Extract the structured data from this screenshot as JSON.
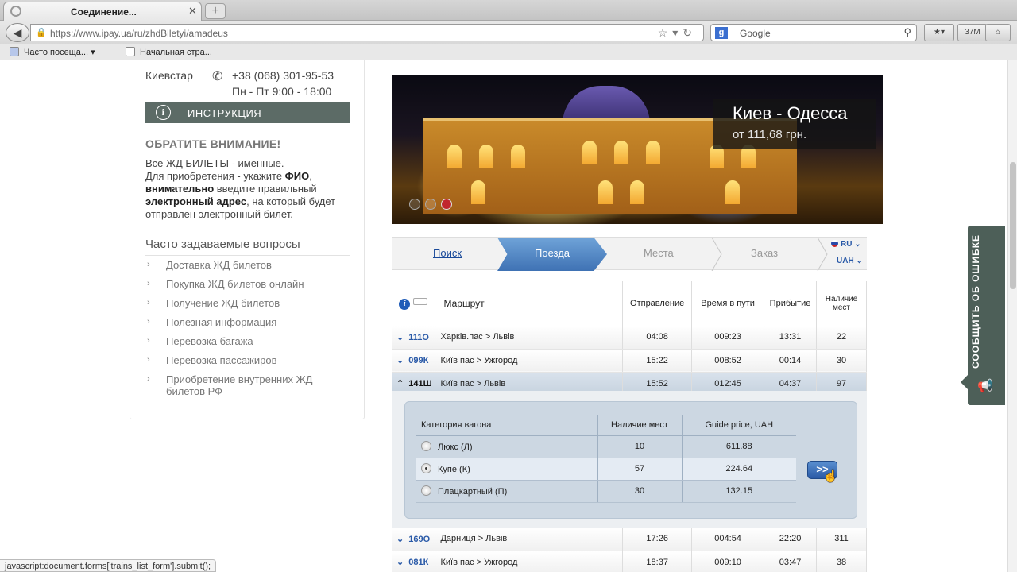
{
  "browser": {
    "tab_title": "Соединение...",
    "new_tab_label": "+",
    "url": "https://www.ipay.ua/ru/zhdBiletyi/amadeus",
    "search_engine": "Google",
    "download_label": "37M",
    "bookmarks": [
      "Часто посеща...",
      "Начальная стра..."
    ],
    "status_text": "javascript:document.forms['trains_list_form'].submit();"
  },
  "sidebar": {
    "contact_operator": "Киевстар",
    "contact_phone": "+38 (068) 301-95-53",
    "contact_hours": "Пн - Пт 9:00 - 18:00",
    "instruction_label": "ИНСТРУКЦИЯ",
    "notice_title": "ОБРАТИТЕ ВНИМАНИЕ!",
    "notice_line1": "Все ЖД БИЛЕТЫ - именные.",
    "notice_p1": "Для приобретения - укажите ",
    "notice_b1": "ФИО",
    "notice_p2": ",",
    "notice_b2": "внимательно",
    "notice_p3": " введите правильный ",
    "notice_b3": "электронный адрес",
    "notice_p4": ", на который будет отправлен электронный билет.",
    "faq_title": "Часто задаваемые вопросы",
    "faq_items": [
      "Доставка ЖД билетов",
      "Покупка ЖД билетов онлайн",
      "Получение ЖД билетов",
      "Полезная информация",
      "Перевозка багажа",
      "Перевозка пассажиров",
      "Приобретение внутренних ЖД билетов РФ"
    ]
  },
  "banner": {
    "route": "Киев - Одесса",
    "price": "от 111,68 грн."
  },
  "steps": {
    "search": "Поиск",
    "trains": "Поезда",
    "seats": "Места",
    "order": "Заказ",
    "language": "RU",
    "currency": "UAH"
  },
  "table": {
    "headers": {
      "route": "Маршрут",
      "departure": "Отправление",
      "duration": "Время в пути",
      "arrival": "Прибытие",
      "availability": "Наличие мест"
    },
    "rows": [
      {
        "number": "111О",
        "route": "Харків.пас > Львів",
        "departure": "04:08",
        "duration": "009:23",
        "arrival": "13:31",
        "seats": "22"
      },
      {
        "number": "099К",
        "route": "Київ пас > Ужгород",
        "departure": "15:22",
        "duration": "008:52",
        "arrival": "00:14",
        "seats": "30"
      },
      {
        "number": "141Ш",
        "route": "Київ пас > Львів",
        "departure": "15:52",
        "duration": "012:45",
        "arrival": "04:37",
        "seats": "97"
      },
      {
        "number": "169О",
        "route": "Дарниця > Львів",
        "departure": "17:26",
        "duration": "004:54",
        "arrival": "22:20",
        "seats": "311"
      },
      {
        "number": "081К",
        "route": "Київ пас > Ужгород",
        "departure": "18:37",
        "duration": "009:10",
        "arrival": "03:47",
        "seats": "38"
      }
    ]
  },
  "detail": {
    "headers": {
      "category": "Категория вагона",
      "availability": "Наличие мест",
      "price": "Guide price, UAH"
    },
    "rows": [
      {
        "category": "Люкс (Л)",
        "seats": "10",
        "price": "611.88"
      },
      {
        "category": "Купе (К)",
        "seats": "57",
        "price": "224.64"
      },
      {
        "category": "Плацкартный (П)",
        "seats": "30",
        "price": "132.15"
      }
    ],
    "go_label": ">>"
  },
  "feedback": {
    "label": "СООБЩИТЬ ОБ ОШИБКЕ"
  },
  "colors": {
    "accent_blue": "#3f72b4",
    "sidebar_button": "#5c6b66",
    "feedback_tab": "#4d5f58"
  }
}
